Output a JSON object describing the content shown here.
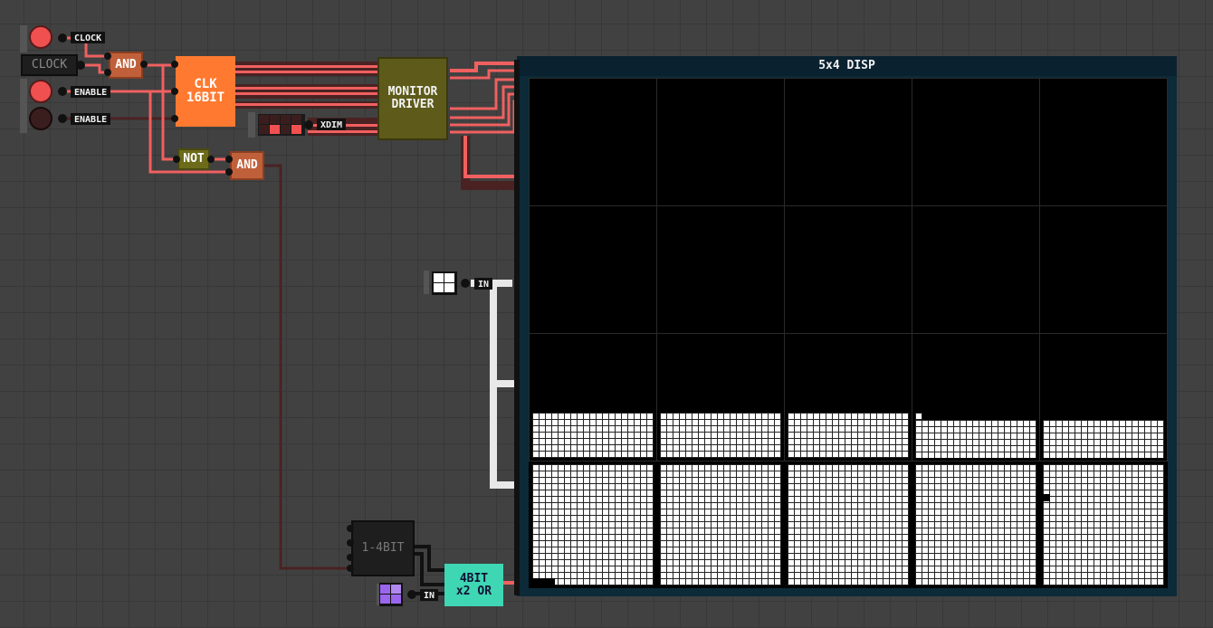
{
  "inputs": [
    {
      "label": "CLOCK",
      "state": "on"
    },
    {
      "label": "ENABLE",
      "state": "on"
    },
    {
      "label": "ENABLE",
      "state": "off"
    }
  ],
  "clock_component": {
    "label": "CLOCK"
  },
  "chips": {
    "and_top": "AND",
    "clk16": "CLK\n16BIT",
    "not": "NOT",
    "and_bottom": "AND",
    "monitor_driver": "MONITOR\nDRIVER",
    "bit_split": "1-4BIT",
    "or_chip": "4BIT\nx2 OR"
  },
  "pin_labels": {
    "xdim": "XDIM",
    "in_white": "IN",
    "in_purple": "IN"
  },
  "display": {
    "title": "5x4 DISP",
    "columns": 5,
    "rows": 4
  },
  "colors": {
    "wire_on": "#f06060",
    "wire_off": "#4a2222",
    "white_bus": "#e8e8e8",
    "clk_chip": "#ff7a30",
    "and_chip": "#c0603a",
    "not_chip": "#6b6b1a",
    "monitor_chip": "#5e5a1a",
    "or_chip": "#3fd6b4",
    "display_frame": "#0c2a38",
    "purple": "#9b66ee"
  }
}
